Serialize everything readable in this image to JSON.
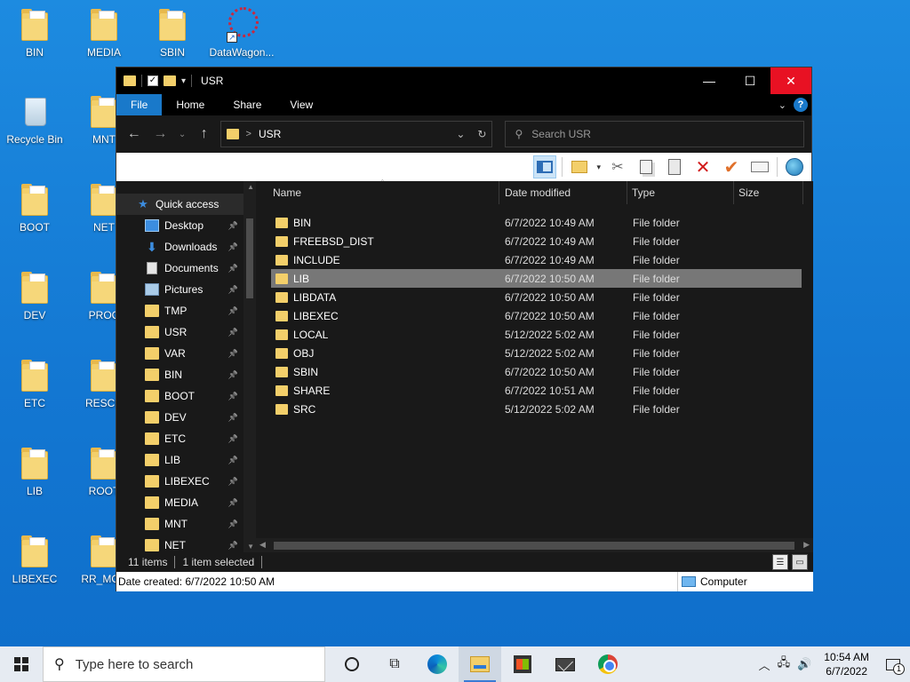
{
  "desktop": {
    "icons": [
      {
        "label": "BIN",
        "kind": "folder"
      },
      {
        "label": "MEDIA",
        "kind": "folder"
      },
      {
        "label": "SBIN",
        "kind": "folder"
      },
      {
        "label": "DataWagon...",
        "kind": "shortcut"
      },
      {
        "label": "Recycle Bin",
        "kind": "recycle-bin"
      },
      {
        "label": "MNT",
        "kind": "folder"
      },
      {
        "label": "BOOT",
        "kind": "folder"
      },
      {
        "label": "NET",
        "kind": "folder"
      },
      {
        "label": "DEV",
        "kind": "folder"
      },
      {
        "label": "PROC",
        "kind": "folder"
      },
      {
        "label": "ETC",
        "kind": "folder"
      },
      {
        "label": "RESCU",
        "kind": "folder"
      },
      {
        "label": "LIB",
        "kind": "folder"
      },
      {
        "label": "ROOT",
        "kind": "folder"
      },
      {
        "label": "LIBEXEC",
        "kind": "folder"
      },
      {
        "label": "RR_MOV",
        "kind": "folder"
      }
    ]
  },
  "window": {
    "title": "USR",
    "controls": {
      "minimize": "—",
      "maximize": "☐",
      "close": "✕"
    },
    "ribbon_tabs": [
      "File",
      "Home",
      "Share",
      "View"
    ],
    "address": {
      "path": "USR",
      "separator": ">"
    },
    "search": {
      "placeholder": "Search USR"
    },
    "nav": {
      "quick_access": "Quick access",
      "items": [
        {
          "label": "Desktop",
          "icon": "desktop-icon"
        },
        {
          "label": "Downloads",
          "icon": "downloads-icon"
        },
        {
          "label": "Documents",
          "icon": "documents-icon"
        },
        {
          "label": "Pictures",
          "icon": "pictures-icon"
        },
        {
          "label": "TMP",
          "icon": "folder-icon"
        },
        {
          "label": "USR",
          "icon": "folder-icon"
        },
        {
          "label": "VAR",
          "icon": "folder-icon"
        },
        {
          "label": "BIN",
          "icon": "folder-icon"
        },
        {
          "label": "BOOT",
          "icon": "folder-icon"
        },
        {
          "label": "DEV",
          "icon": "folder-icon"
        },
        {
          "label": "ETC",
          "icon": "folder-icon"
        },
        {
          "label": "LIB",
          "icon": "folder-icon"
        },
        {
          "label": "LIBEXEC",
          "icon": "folder-icon"
        },
        {
          "label": "MEDIA",
          "icon": "folder-icon"
        },
        {
          "label": "MNT",
          "icon": "folder-icon"
        },
        {
          "label": "NET",
          "icon": "folder-icon"
        }
      ]
    },
    "columns": {
      "name": "Name",
      "date": "Date modified",
      "type": "Type",
      "size": "Size"
    },
    "files": [
      {
        "name": "BIN",
        "date": "6/7/2022 10:49 AM",
        "type": "File folder",
        "selected": false
      },
      {
        "name": "FREEBSD_DIST",
        "date": "6/7/2022 10:49 AM",
        "type": "File folder",
        "selected": false
      },
      {
        "name": "INCLUDE",
        "date": "6/7/2022 10:49 AM",
        "type": "File folder",
        "selected": false
      },
      {
        "name": "LIB",
        "date": "6/7/2022 10:50 AM",
        "type": "File folder",
        "selected": true
      },
      {
        "name": "LIBDATA",
        "date": "6/7/2022 10:50 AM",
        "type": "File folder",
        "selected": false
      },
      {
        "name": "LIBEXEC",
        "date": "6/7/2022 10:50 AM",
        "type": "File folder",
        "selected": false
      },
      {
        "name": "LOCAL",
        "date": "5/12/2022 5:02 AM",
        "type": "File folder",
        "selected": false
      },
      {
        "name": "OBJ",
        "date": "5/12/2022 5:02 AM",
        "type": "File folder",
        "selected": false
      },
      {
        "name": "SBIN",
        "date": "6/7/2022 10:50 AM",
        "type": "File folder",
        "selected": false
      },
      {
        "name": "SHARE",
        "date": "6/7/2022 10:51 AM",
        "type": "File folder",
        "selected": false
      },
      {
        "name": "SRC",
        "date": "5/12/2022 5:02 AM",
        "type": "File folder",
        "selected": false
      }
    ],
    "status": {
      "count": "11 items",
      "selection": "1 item selected"
    },
    "details": {
      "created": "Date created: 6/7/2022 10:50 AM",
      "location": "Computer"
    }
  },
  "taskbar": {
    "search_placeholder": "Type here to search",
    "time": "10:54 AM",
    "date": "6/7/2022",
    "notifications": "1"
  }
}
